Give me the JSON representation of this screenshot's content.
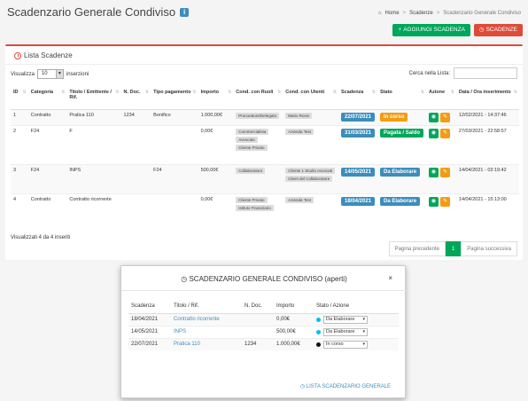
{
  "page": {
    "title": "Scadenzario Generale Condiviso",
    "info_badge": "i"
  },
  "breadcrumb": {
    "home": "Home",
    "sep": ">",
    "item1": "Scadenze",
    "item2": "Scadenzario Generale Condiviso"
  },
  "toolbar": {
    "add_label": "AGGIUNGI SCADENZA",
    "scadenze_label": "SCADENZE"
  },
  "box": {
    "title": "Lista Scadenze",
    "show_label": "Visualizza",
    "show_value": "10",
    "entries_label": "inserzioni",
    "search_label": "Cerca nella Lista:",
    "info": "Visualizzati 4 da 4 inseriti",
    "prev": "Pagina precedente",
    "page": "1",
    "next": "Pagina successiva"
  },
  "table": {
    "headers": [
      "ID",
      "Categoria",
      "Titolo / Emittente / Rif.",
      "N. Doc.",
      "Tipo pagamento",
      "Importo",
      "Cond. con Ruoli",
      "Cond. con Utenti",
      "Scadenza",
      "Stato",
      "Azione",
      "Data / Ora inserimento"
    ],
    "rows": [
      {
        "id": "1",
        "categoria": "Contratto",
        "titolo": "Pratica 110",
        "ndoc": "1234",
        "tipo": "Bonifico",
        "importo": "1.000,00€",
        "ruoli": [
          "Procuratore/Delegato"
        ],
        "utenti": [
          "Mario Rossi"
        ],
        "scadenza": "22/07/2021",
        "stato": "In corso",
        "stato_color": "#f39c12",
        "data": "12/02/2021 - 14:37:46"
      },
      {
        "id": "2",
        "categoria": "F24",
        "titolo": "F",
        "ndoc": "",
        "tipo": "",
        "importo": "0,00€",
        "ruoli": [
          "Commercialista",
          "Avvocato",
          "Cliente Privato"
        ],
        "utenti": [
          "Azienda Test"
        ],
        "scadenza": "31/03/2021",
        "stato": "Pagata / Saldo",
        "stato_color": "#00a65a",
        "data": "27/03/2021 - 22:58:57"
      },
      {
        "id": "3",
        "categoria": "F24",
        "titolo": "INPS",
        "ndoc": "",
        "tipo": "F24",
        "importo": "500,00€",
        "ruoli": [
          "Collaboratore"
        ],
        "utenti": [
          "Cliente 1 Studio Avvocati",
          "Client del Collaboratore"
        ],
        "scadenza": "14/05/2021",
        "stato": "Da Elaborare",
        "stato_color": "#3c8dbc",
        "data": "14/04/2021 - 03:19:42"
      },
      {
        "id": "4",
        "categoria": "Contratto",
        "titolo": "Contratto ricorrente",
        "ndoc": "",
        "tipo": "",
        "importo": "0,00€",
        "ruoli": [
          "Cliente Privato",
          "Istituto Finanziario"
        ],
        "utenti": [
          "Azienda Test"
        ],
        "scadenza": "18/04/2021",
        "stato": "Da Elaborare",
        "stato_color": "#3c8dbc",
        "data": "14/04/2021 - 15:13:00"
      }
    ]
  },
  "modal": {
    "title": "SCADENZARIO GENERALE CONDIVISO (aperti)",
    "close": "×",
    "headers": [
      "Scadenza",
      "Titolo / Rif.",
      "N. Doc.",
      "Importo",
      "Stato / Azione"
    ],
    "rows": [
      {
        "scadenza": "18/04/2021",
        "titolo": "Contratto ricorrente",
        "ndoc": "",
        "importo": "0,00€",
        "stato": "Da Elaborare",
        "dot": "#00c0ef"
      },
      {
        "scadenza": "14/05/2021",
        "titolo": "INPS",
        "ndoc": "",
        "importo": "500,00€",
        "stato": "Da Elaborare",
        "dot": "#00c0ef"
      },
      {
        "scadenza": "22/07/2021",
        "titolo": "Pratica 110",
        "ndoc": "1234",
        "importo": "1.000,00€",
        "stato": "In corso",
        "dot": "#111111"
      }
    ],
    "footer_link": "LISTA SCADENZARIO GENERALE"
  }
}
